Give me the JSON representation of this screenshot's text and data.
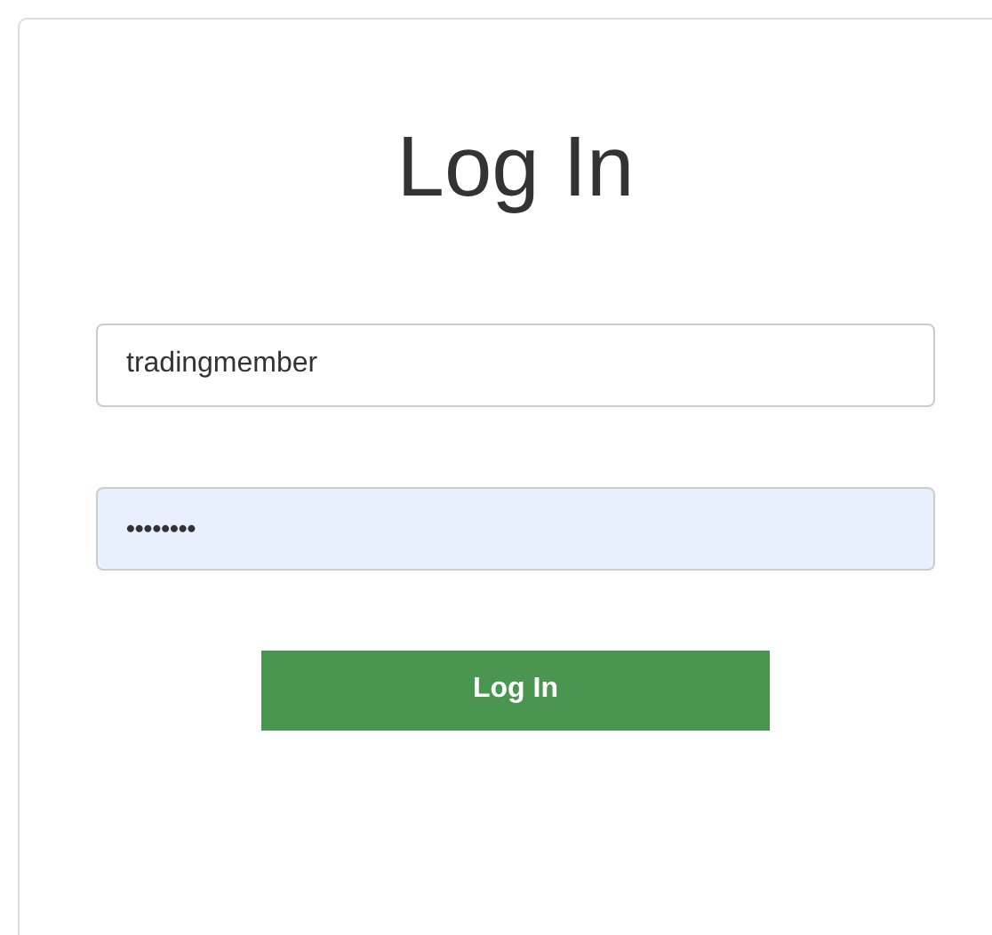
{
  "title": "Log In",
  "fields": [
    {
      "kind": "text",
      "value": "tradingmember",
      "autofilled": false
    },
    {
      "kind": "password",
      "value": "••••••••",
      "autofilled": true
    }
  ],
  "button": {
    "label": "Log In"
  }
}
